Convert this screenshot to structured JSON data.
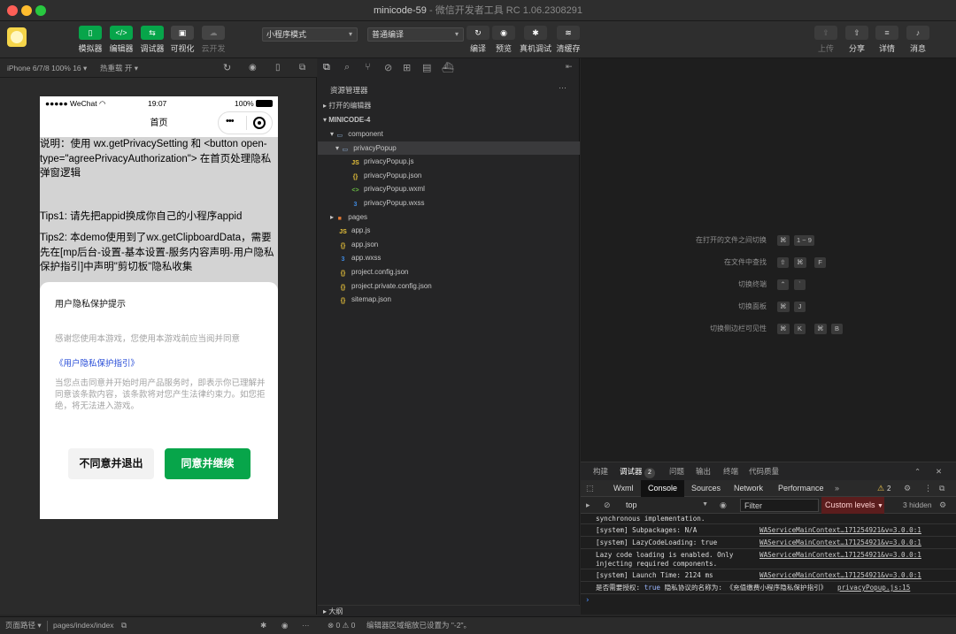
{
  "window": {
    "title_app": "minicode-59",
    "title_rest": " - 微信开发者工具 RC 1.06.2308291"
  },
  "toolbar": {
    "simulator": "模拟器",
    "editor": "编辑器",
    "debugger": "调试器",
    "visual": "可视化",
    "cloud": "云开发",
    "mode_select": "小程序模式",
    "compile_select": "普通编译",
    "compile": "编译",
    "preview": "预览",
    "real_debug": "真机调试",
    "clear_cache": "清缓存",
    "upload": "上传",
    "share": "分享",
    "details": "详情",
    "messages": "消息"
  },
  "simbar": {
    "device": "iPhone 6/7/8 100% 16",
    "hotreload": "热重载 开"
  },
  "phone": {
    "carrier": "●●●●● WeChat",
    "time": "19:07",
    "battery": "100%",
    "nav_title": "首页",
    "desc": "说明：使用 wx.getPrivacySetting 和 <button open-type=\"agreePrivacyAuthorization\"> 在首页处理隐私弹窗逻辑",
    "tips1": "Tips1: 请先把appid换成你自己的小程序appid",
    "tips2": "Tips2: 本demo使用到了wx.getClipboardData，需要先在[mp后台-设置-基本设置-服务内容声明-用户隐私保护指引]中声明\"剪切板\"隐私收集",
    "modal": {
      "title": "用户隐私保护提示",
      "intro": "感谢您使用本游戏，您使用本游戏前应当阅并同意",
      "link": "《用户隐私保护指引》",
      "body": "当您点击同意并开始时用产品服务时，即表示你已理解并同意该条款内容，该条款将对您产生法律约束力。如您拒绝，将无法进入游戏。",
      "reject": "不同意并退出",
      "accept": "同意并继续"
    }
  },
  "explorer": {
    "header": "资源管理器",
    "open_editors": "打开的编辑器",
    "project": "MINICODE-4",
    "tree": [
      {
        "label": "component",
        "type": "folder",
        "indent": 1
      },
      {
        "label": "privacyPopup",
        "type": "folder",
        "indent": 2
      },
      {
        "label": "privacyPopup.js",
        "type": "js",
        "indent": 3
      },
      {
        "label": "privacyPopup.json",
        "type": "json",
        "indent": 3
      },
      {
        "label": "privacyPopup.wxml",
        "type": "wxml",
        "indent": 3
      },
      {
        "label": "privacyPopup.wxss",
        "type": "wxss",
        "indent": 3
      },
      {
        "label": "pages",
        "type": "folder-orange",
        "indent": 1
      },
      {
        "label": "app.js",
        "type": "js",
        "indent": 1
      },
      {
        "label": "app.json",
        "type": "json",
        "indent": 1
      },
      {
        "label": "app.wxss",
        "type": "wxss",
        "indent": 1
      },
      {
        "label": "project.config.json",
        "type": "json",
        "indent": 1
      },
      {
        "label": "project.private.config.json",
        "type": "json",
        "indent": 1
      },
      {
        "label": "sitemap.json",
        "type": "json",
        "indent": 1
      }
    ],
    "outline": "大纲"
  },
  "shortcuts": [
    {
      "label": "在打开的文件之间切换",
      "keys": [
        "⌘",
        "1 ~ 9"
      ]
    },
    {
      "label": "在文件中查找",
      "keys": [
        "⇧",
        "⌘",
        "F"
      ]
    },
    {
      "label": "切换终端",
      "keys": [
        "⌃",
        "`"
      ]
    },
    {
      "label": "切换面板",
      "keys": [
        "⌘",
        "J"
      ]
    },
    {
      "label": "切换侧边栏可见性",
      "keys": [
        "⌘",
        "K",
        "⌘",
        "B"
      ]
    }
  ],
  "debug": {
    "tabs": [
      "构建",
      "调试器",
      "问题",
      "输出",
      "终端",
      "代码质量"
    ],
    "debugger_badge": "2",
    "console_tabs": [
      "Wxml",
      "Console",
      "Sources",
      "Network",
      "Performance"
    ],
    "warn_count": "2",
    "context": "top",
    "filter_placeholder": "Filter",
    "levels": "Custom levels",
    "hidden": "3 hidden",
    "logs": [
      {
        "text": "synchronous implementation.",
        "src": ""
      },
      {
        "text": "[system] Subpackages: N/A",
        "src": "WAServiceMainContext…171254921&v=3.0.0:1"
      },
      {
        "text": "[system] LazyCodeLoading: true",
        "src": "WAServiceMainContext…171254921&v=3.0.0:1"
      },
      {
        "text": "Lazy code loading is enabled. Only",
        "text2": "injecting required components.",
        "src": "WAServiceMainContext…171254921&v=3.0.0:1"
      },
      {
        "text": "[system] Launch Time: 2124 ms",
        "src": "WAServiceMainContext…171254921&v=3.0.0:1"
      }
    ],
    "last_log": {
      "prefix": "是否需要授权:",
      "bool": "true",
      "mid": "隐私协议的名称为:",
      "name": "《充值缴费小程序隐私保护指引》",
      "src": "privacyPopup.js:15"
    }
  },
  "bottombar": {
    "path_label": "页面路径",
    "path": "pages/index/index",
    "errors": "0",
    "warnings": "0",
    "status": "编辑器区域缩放已设置为 \"-2\"。"
  }
}
